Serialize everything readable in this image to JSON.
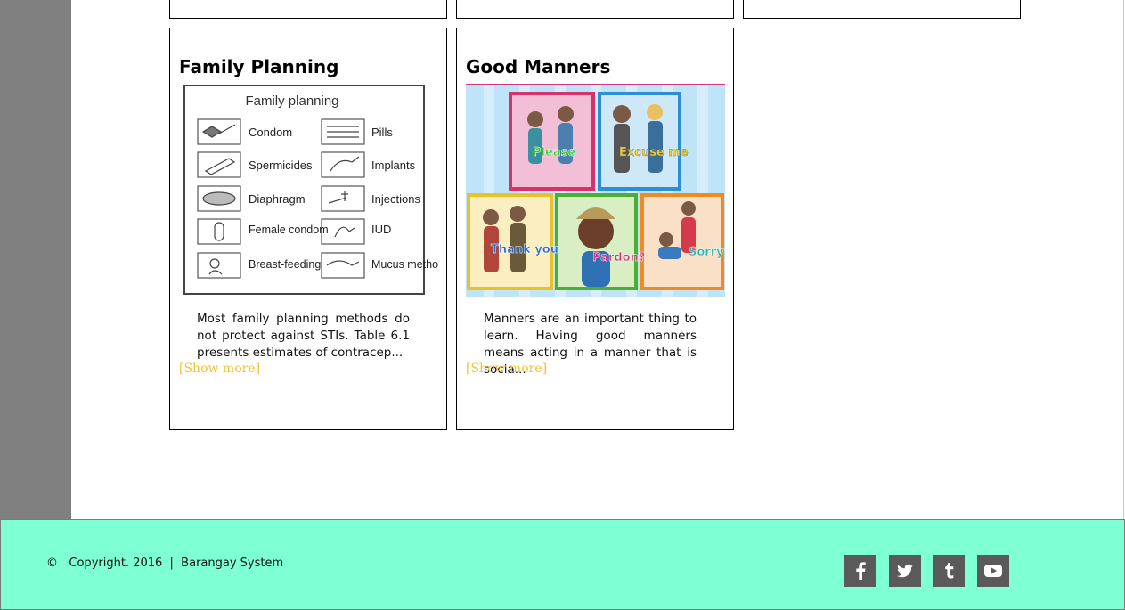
{
  "cards": [
    {
      "title": "Family Planning",
      "description": "Most family planning methods do not protect against STIs. Table 6.1 presents estimates of contracep...",
      "show_more": "[Show more]",
      "image": {
        "heading": "Family planning",
        "items": [
          "Condom",
          "Pills",
          "Spermicides",
          "Implants",
          "Diaphragm",
          "Injections",
          "Female condom",
          "IUD",
          "Breast-feeding",
          "Mucus method"
        ]
      }
    },
    {
      "title": "Good Manners",
      "description": "Manners are an important thing to learn. Having good manners means acting in a manner that is socia...",
      "show_more": "[Show more]",
      "image": {
        "panels": [
          "Please",
          "Excuse me",
          "Thank you",
          "Pardon?",
          "Sorry"
        ]
      }
    }
  ],
  "footer": {
    "copyright_symbol": "©",
    "copyright_text": "Copyright. 2016  |  Barangay System",
    "social_icons": [
      "facebook-icon",
      "twitter-icon",
      "tumblr-icon",
      "youtube-icon"
    ]
  },
  "colors": {
    "footer_bg": "#7fffd4",
    "sidebar_strip": "#808080",
    "show_more": "#f1c232",
    "social_bg": "#5a5a5a"
  }
}
